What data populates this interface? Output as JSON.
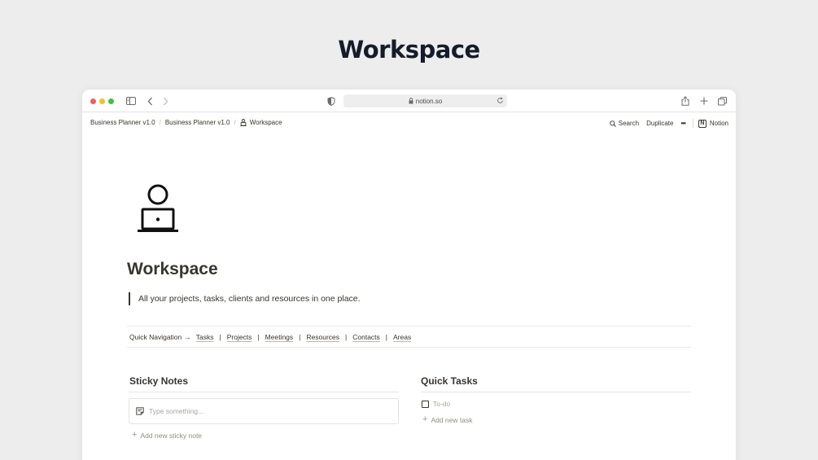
{
  "hero": {
    "title": "Workspace"
  },
  "browser": {
    "url": "notion.so",
    "traffic_lights": {
      "close": "#f25f58",
      "minimize": "#f9be2e",
      "zoom": "#3bc53b"
    },
    "toolbar_icons": [
      "sidebar-icon",
      "back-chevron-icon",
      "forward-chevron-icon",
      "shield-icon",
      "lock-icon",
      "reload-icon",
      "share-icon",
      "new-tab-plus-icon",
      "tabs-overview-icon"
    ]
  },
  "notion_bar": {
    "breadcrumbs": [
      "Business Planner v1.0",
      "Business Planner v1.0",
      "Workspace"
    ],
    "breadcrumb_separator": "/",
    "search_label": "Search",
    "duplicate_label": "Duplicate",
    "more_label": "•••",
    "notion_label": "Notion",
    "notion_logo_letter": "N"
  },
  "page": {
    "icon": "person-at-laptop-icon",
    "title": "Workspace",
    "quote": "All your projects, tasks, clients and resources in one place.",
    "quick_nav": {
      "label": "Quick Navigation",
      "arrow": "→",
      "separator": "|",
      "links": [
        "Tasks",
        "Projects",
        "Meetings",
        "Resources",
        "Contacts",
        "Areas"
      ]
    },
    "sticky_notes": {
      "heading": "Sticky Notes",
      "placeholder": "Type something...",
      "add_label": "Add new sticky note"
    },
    "quick_tasks": {
      "heading": "Quick Tasks",
      "todo_placeholder": "To-do",
      "add_label": "Add new task"
    }
  }
}
